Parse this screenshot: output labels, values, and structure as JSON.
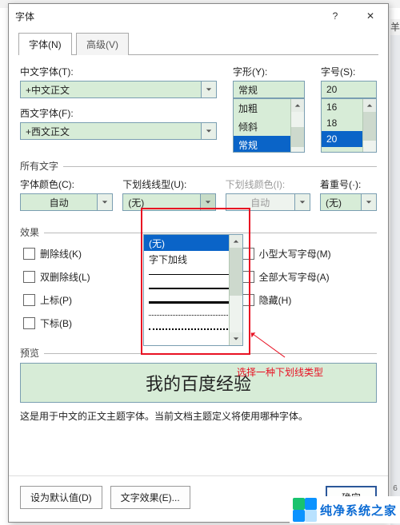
{
  "dialog_title": "字体",
  "tabs": {
    "font": "字体(N)",
    "advanced": "高级(V)"
  },
  "labels": {
    "cn_font": "中文字体(T):",
    "en_font": "西文字体(F):",
    "style": "字形(Y):",
    "size": "字号(S):",
    "all_text": "所有文字",
    "font_color": "字体颜色(C):",
    "underline_type": "下划线线型(U):",
    "underline_color": "下划线颜色(I):",
    "emphasis": "着重号(·):",
    "effects": "效果",
    "preview": "预览",
    "desc": "这是用于中文的正文主题字体。当前文档主题定义将使用哪种字体。"
  },
  "values": {
    "cn_font": "+中文正文",
    "en_font": "+西文正文",
    "style_input": "常规",
    "size_input": "20",
    "font_color": "自动",
    "underline_type": "(无)",
    "underline_color": "自动",
    "emphasis": "(无)"
  },
  "style_options": [
    "常规",
    "倾斜",
    "加粗"
  ],
  "style_selected_index": 0,
  "size_options": [
    "16",
    "18",
    "20"
  ],
  "size_selected_index": 2,
  "underline_options": {
    "text_items": [
      "(无)",
      "字下加线"
    ],
    "selected_index": 0
  },
  "checkboxes": {
    "left": [
      "删除线(K)",
      "双删除线(L)",
      "上标(P)",
      "下标(B)"
    ],
    "right": [
      "小型大写字母(M)",
      "全部大写字母(A)",
      "隐藏(H)"
    ]
  },
  "preview_text": "我的百度经验",
  "footer": {
    "default": "设为默认值(D)",
    "text_effects": "文字效果(E)...",
    "ok": "确定"
  },
  "annotation": "选择一种下划线类型",
  "watermark_text": "纯净系统之家",
  "ribbon_hint": "羊",
  "right_num": "6"
}
